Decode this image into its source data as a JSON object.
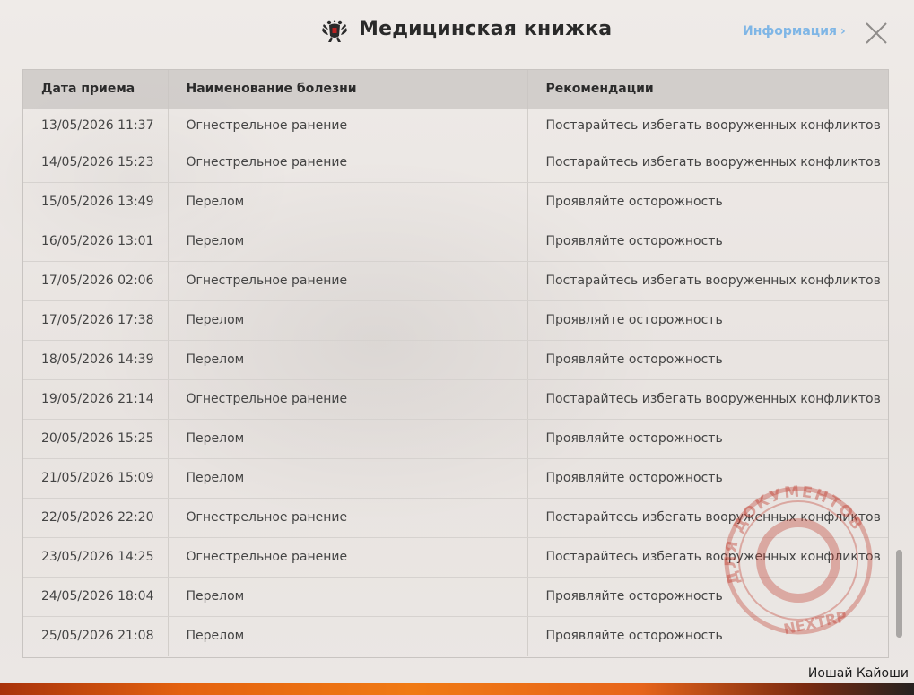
{
  "header": {
    "title": "Медицинская книжка",
    "info_link": "Информация",
    "emblem_icon": "double-headed-eagle-icon",
    "close_icon": "close-icon"
  },
  "table": {
    "columns": [
      "Дата приема",
      "Наименование болезни",
      "Рекомендации"
    ],
    "rows": [
      {
        "date": "13/05/2026 11:37",
        "disease": "Огнестрельное ранение",
        "recommendation": "Постарайтесь избегать вооруженных конфликтов"
      },
      {
        "date": "14/05/2026 15:23",
        "disease": "Огнестрельное ранение",
        "recommendation": "Постарайтесь избегать вооруженных конфликтов"
      },
      {
        "date": "15/05/2026 13:49",
        "disease": "Перелом",
        "recommendation": "Проявляйте осторожность"
      },
      {
        "date": "16/05/2026 13:01",
        "disease": "Перелом",
        "recommendation": "Проявляйте осторожность"
      },
      {
        "date": "17/05/2026 02:06",
        "disease": "Огнестрельное ранение",
        "recommendation": "Постарайтесь избегать вооруженных конфликтов"
      },
      {
        "date": "17/05/2026 17:38",
        "disease": "Перелом",
        "recommendation": "Проявляйте осторожность"
      },
      {
        "date": "18/05/2026 14:39",
        "disease": "Перелом",
        "recommendation": "Проявляйте осторожность"
      },
      {
        "date": "19/05/2026 21:14",
        "disease": "Огнестрельное ранение",
        "recommendation": "Постарайтесь избегать вооруженных конфликтов"
      },
      {
        "date": "20/05/2026 15:25",
        "disease": "Перелом",
        "recommendation": "Проявляйте осторожность"
      },
      {
        "date": "21/05/2026 15:09",
        "disease": "Перелом",
        "recommendation": "Проявляйте осторожность"
      },
      {
        "date": "22/05/2026 22:20",
        "disease": "Огнестрельное ранение",
        "recommendation": "Постарайтесь избегать вооруженных конфликтов"
      },
      {
        "date": "23/05/2026 14:25",
        "disease": "Огнестрельное ранение",
        "recommendation": "Постарайтесь избегать вооруженных конфликтов"
      },
      {
        "date": "24/05/2026 18:04",
        "disease": "Перелом",
        "recommendation": "Проявляйте осторожность"
      },
      {
        "date": "25/05/2026 21:08",
        "disease": "Перелом",
        "recommendation": "Проявляйте осторожность"
      }
    ]
  },
  "stamp": {
    "text_top": "ДЛЯ ДОКУМЕНТОВ",
    "text_bottom": "NEXTRP",
    "color": "#c0392b"
  },
  "footer": {
    "username": "Иошай Кайоши"
  }
}
